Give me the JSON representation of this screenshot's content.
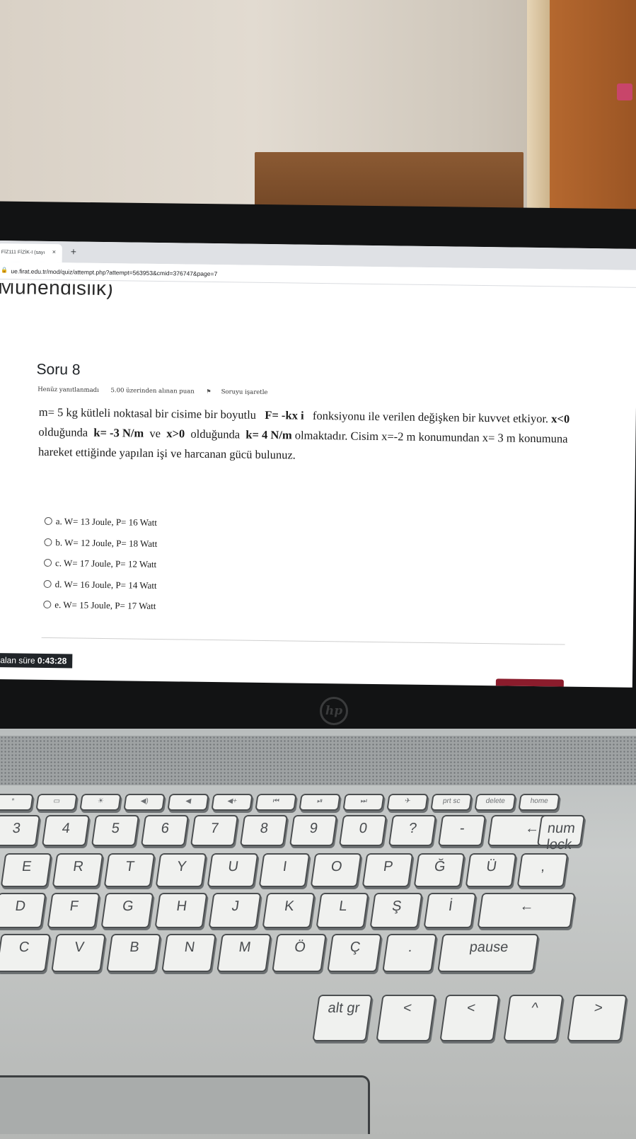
{
  "browser": {
    "tab_title": "FİZ111 FİZİK-I (sayı",
    "tab_close": "×",
    "new_tab": "+",
    "url": "ue.firat.edu.tr/mod/quiz/attempt.php?attempt=563953&cmid=376747&page=7"
  },
  "course": {
    "title": "Mühendislik)"
  },
  "question": {
    "title": "Soru 8",
    "status": "Henüz yanıtlanmadı",
    "points": "5.00 üzerinden alınan puan",
    "flag": "Soruyu işaretle",
    "text_1": "m= 5 kg kütleli noktasal bir cisime bir boyutlu",
    "formula": "F= -kx i",
    "text_2": "fonksiyonu ile verilen değişken bir kuvvet etkiyor.",
    "cond1": "x<0",
    "text_3": "olduğunda",
    "k1": "k= -3 N/m",
    "text_4": "ve",
    "cond2": "x>0",
    "text_5": "olduğunda",
    "k2": "k= 4 N/m",
    "text_6": "olmaktadır. Cisim  x=-2 m konumundan  x= 3 m  konumuna hareket ettiğinde yapılan işi ve harcanan gücü bulunuz.",
    "answers": [
      "a. W= 13 Joule,  P= 16 Watt",
      "b. W= 12 Joule,  P= 18 Watt",
      "c. W= 17 Joule,  P= 12 Watt",
      "d. W= 16 Joule,  P= 14 Watt",
      "e. W= 15 Joule,  P= 17 Watt"
    ]
  },
  "timer": {
    "label": "Kalan süre",
    "value": "0:43:28"
  },
  "laptop": {
    "brand": "hp",
    "fn_keys": [
      "*",
      "▭",
      "☀",
      "◀)",
      "◀",
      "◀+",
      "⏮",
      "⏯",
      "⏭",
      "✈",
      "prt sc",
      "delete",
      "home"
    ],
    "row1": [
      "3",
      "4",
      "5",
      "6",
      "7",
      "8",
      "9",
      "0",
      "?",
      "-",
      "←",
      "num lock"
    ],
    "row2": [
      "E",
      "R",
      "T",
      "Y",
      "U",
      "I",
      "O",
      "P",
      "Ğ",
      "Ü",
      ","
    ],
    "row3": [
      "D",
      "F",
      "G",
      "H",
      "J",
      "K",
      "L",
      "Ş",
      "İ",
      "←"
    ],
    "row4": [
      "C",
      "V",
      "B",
      "N",
      "M",
      "Ö",
      "Ç",
      ".",
      "pause"
    ],
    "row5": [
      "alt gr",
      "<",
      "<",
      "^",
      ">"
    ]
  }
}
